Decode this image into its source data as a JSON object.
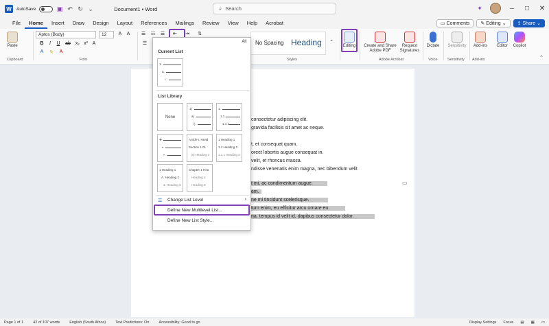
{
  "titlebar": {
    "autosave": "AutoSave",
    "doc_title": "Document1 • Word",
    "search_placeholder": "Search"
  },
  "menu": [
    "File",
    "Home",
    "Insert",
    "Draw",
    "Design",
    "Layout",
    "References",
    "Mailings",
    "Review",
    "View",
    "Help",
    "Acrobat"
  ],
  "menu_right": {
    "comments": "Comments",
    "editing": "Editing",
    "share": "Share"
  },
  "ribbon": {
    "paste": "Paste",
    "clipboard": "Clipboard",
    "font": "Font",
    "font_name": "Aptos (Body)",
    "font_size": "12",
    "style_no_spacing": "No Spacing",
    "style_heading": "Heading",
    "styles_group": "Styles",
    "editing": "Editing",
    "create_share_pdf": "Create and Share Adobe PDF",
    "request_signatures": "Request Signatures",
    "adobe_acrobat": "Adobe Acrobat",
    "dictate": "Dictate",
    "voice": "Voice",
    "sensitivity": "Sensitivity",
    "add_ins": "Add-ins",
    "editor": "Editor",
    "copilot": "Copilot"
  },
  "dropdown": {
    "all": "All",
    "current_list": "Current List",
    "list_library": "List Library",
    "none": "None",
    "thumb_numbered": [
      "1)",
      "a)",
      "i)"
    ],
    "thumb_outline": [
      "1.",
      "1.1.",
      "1.1.1."
    ],
    "thumb_article": [
      "Article I. Head",
      "Section 1.01",
      "(a) Heading 3"
    ],
    "thumb_heading_num": [
      "1 Heading 1",
      "1.1 Heading 2",
      "1.1.1 Heading 3"
    ],
    "thumb_heading_plain": [
      "1 Heading 1",
      "A. Heading 2",
      "1. Heading 3"
    ],
    "thumb_chapter": [
      "Chapter 1 Hea",
      "Heading 2",
      "Heading 3"
    ],
    "current_thumb": [
      "1.",
      "a.",
      "i."
    ],
    "change_level": "Change List Level",
    "define_multilevel": "Define New Multilevel List...",
    "define_style": "Define New List Style..."
  },
  "document": {
    "lines": [
      "consectetur adipiscing elit.",
      "gravida facilisis sit amet ac neque.",
      "t, et consequat quam.",
      "oreet lobortis augue consequat in.",
      "velit, et rhoncus massa.",
      "ndisse venenatis enim magna, nec bibendum velit",
      "t mi, ac condimentum augue.",
      "em.",
      "ne mi tincidunt scelerisque.",
      "tum enim, eu efficitur arcu ornare eu.",
      "na, tempus id velit id, dapibus consectetur dolor."
    ]
  },
  "status": {
    "page": "Page 1 of 1",
    "words": "42 of 107 words",
    "language": "English (South Africa)",
    "predictions": "Text Predictions: On",
    "accessibility": "Accessibility: Good to go",
    "display": "Display Settings",
    "focus": "Focus"
  }
}
